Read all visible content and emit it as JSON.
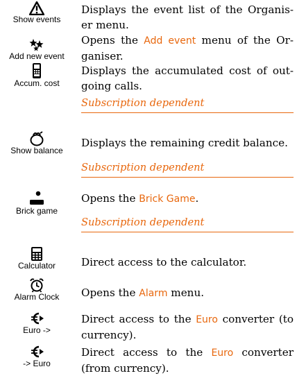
{
  "rows": [
    {
      "label": "Show events",
      "icon": "warning-triangle-icon",
      "text": {
        "pre": "Displays the event list of the Organis-er menu.",
        "kw": "",
        "post": ""
      }
    },
    {
      "label": "Add new event",
      "icon": "sparkle-icon",
      "text": {
        "pre": "Opens the ",
        "kw": "Add event",
        "post": " menu of the Or-ganiser."
      }
    },
    {
      "label": "Accum. cost",
      "icon": "phone-icon",
      "text": {
        "pre": "Displays the accumulated cost of out-going calls.",
        "kw": "",
        "post": ""
      }
    },
    {
      "label": "Show balance",
      "icon": "wallet-icon",
      "text": {
        "pre": "Displays the remaining credit balance.",
        "kw": "",
        "post": ""
      }
    },
    {
      "label": "Brick game",
      "icon": "brick-game-icon",
      "text": {
        "pre": "Opens the ",
        "kw": "Brick Game",
        "post": "."
      }
    },
    {
      "label": "Calculator",
      "icon": "calculator-icon",
      "text": {
        "pre": "Direct access to the calculator.",
        "kw": "",
        "post": ""
      }
    },
    {
      "label": "Alarm Clock",
      "icon": "alarm-clock-icon",
      "text": {
        "pre": "Opens the ",
        "kw": "Alarm",
        "post": " menu."
      }
    },
    {
      "label": "Euro ->",
      "icon": "euro-icon",
      "text": {
        "pre": "Direct access to the ",
        "kw": "Euro",
        "post": " converter (to currency)."
      }
    },
    {
      "label": "-> Euro",
      "icon": "euro-icon",
      "text": {
        "pre": "Direct access to the ",
        "kw": "Euro",
        "post": " converter (from currency)."
      }
    }
  ],
  "subscription_note": "Subscription dependent",
  "colors": {
    "accent": "#e8670d",
    "text": "#000000"
  }
}
